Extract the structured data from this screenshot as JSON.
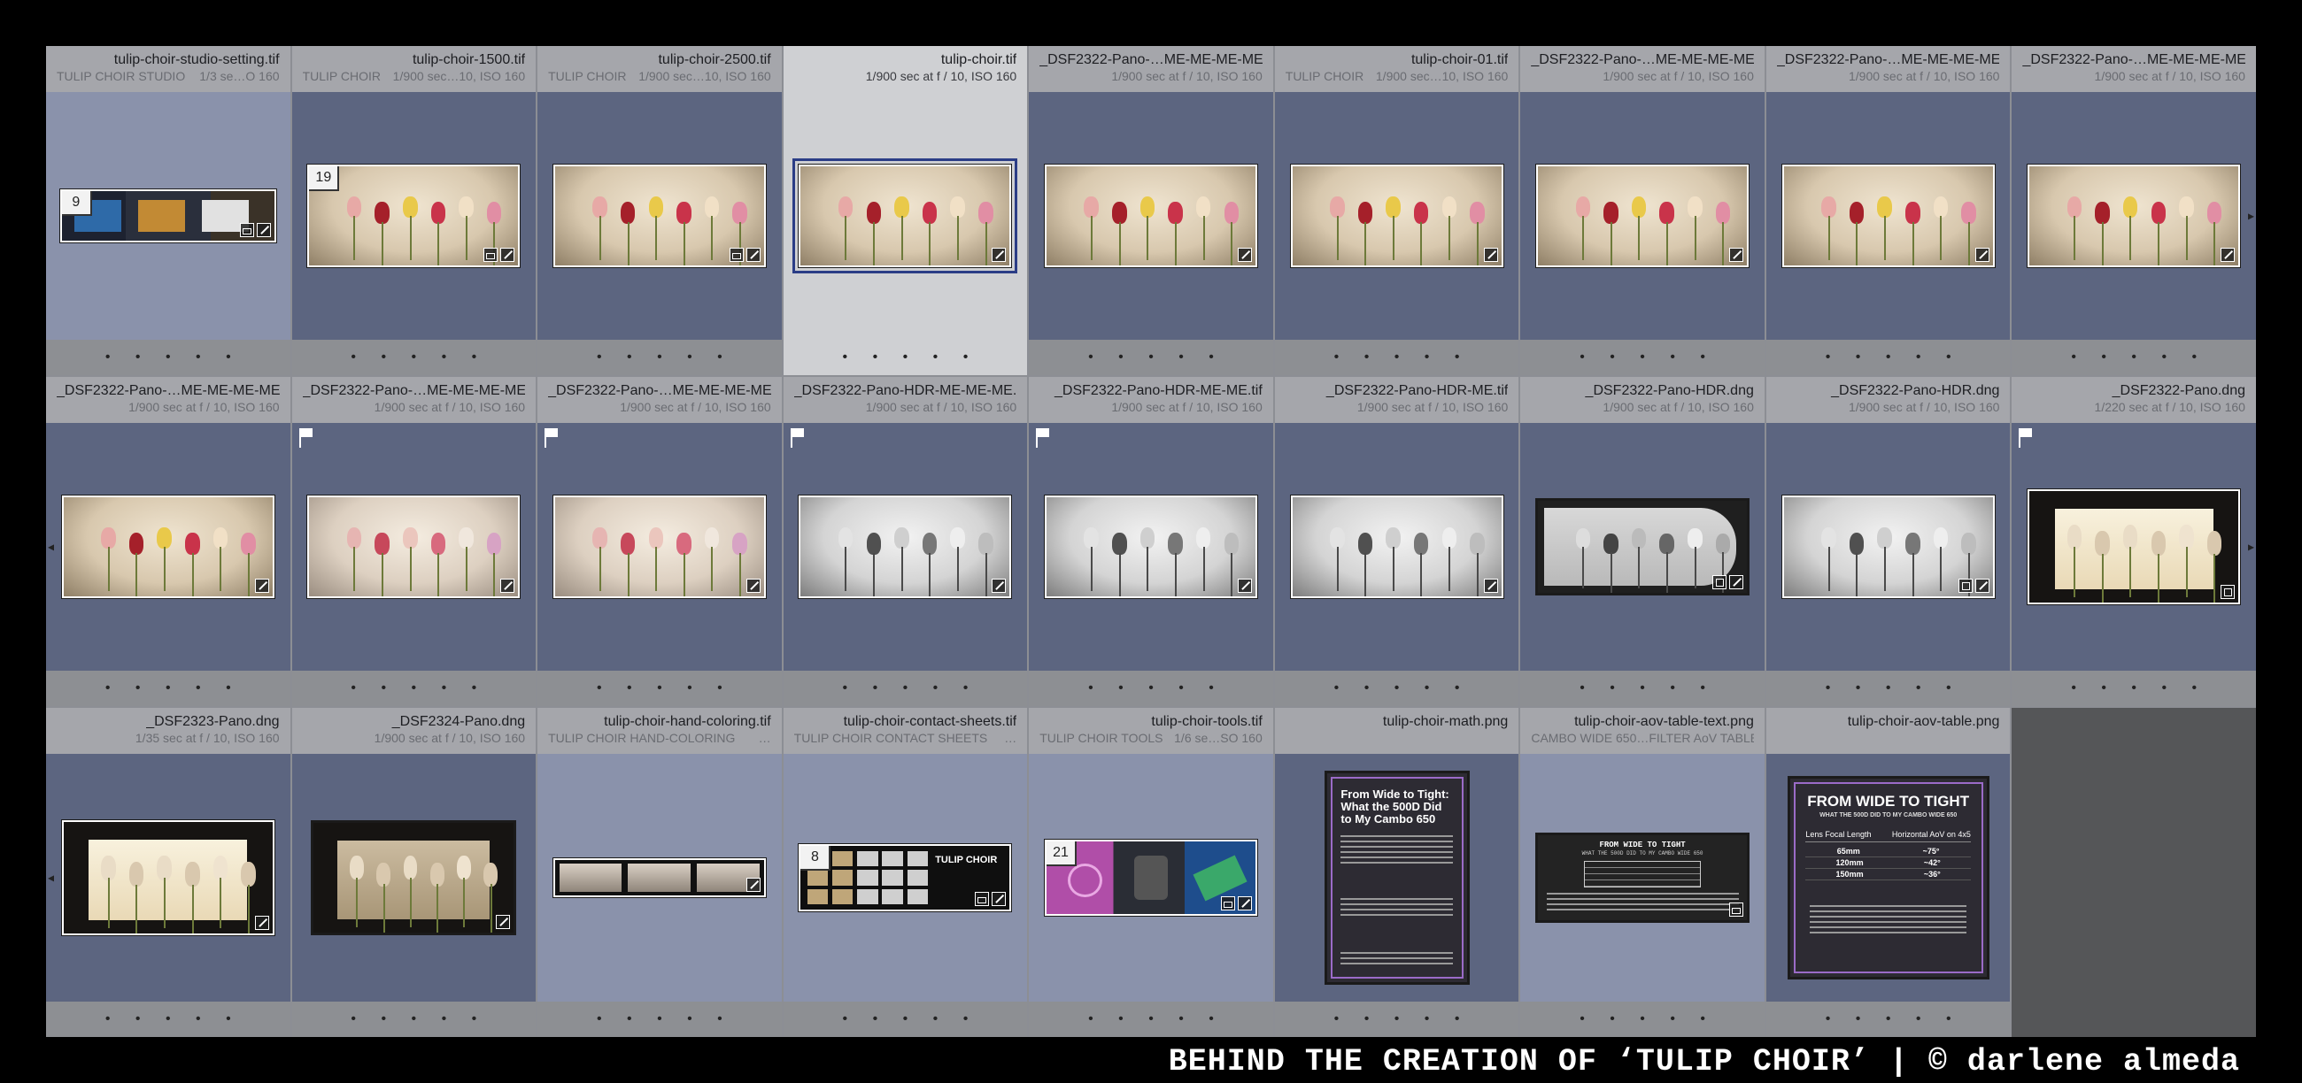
{
  "grid": {
    "cells": [
      {
        "filename": "tulip-choir-studio-setting.tif",
        "meta_left": "TULIP CHOIR STUDIO",
        "meta_right": "1/3 se…O 160",
        "badge": "9",
        "icons": [
          "stack",
          "edit"
        ],
        "flag": false
      },
      {
        "filename": "tulip-choir-1500.tif",
        "meta_left": "TULIP CHOIR",
        "meta_right": "1/900 sec…10, ISO 160",
        "badge": "19",
        "icons": [
          "stack",
          "edit"
        ],
        "flag": false
      },
      {
        "filename": "tulip-choir-2500.tif",
        "meta_left": "TULIP CHOIR",
        "meta_right": "1/900 sec…10, ISO 160",
        "badge": "",
        "icons": [
          "stack",
          "edit"
        ],
        "flag": false
      },
      {
        "filename": "tulip-choir.tif",
        "meta_left": "",
        "meta_right": "1/900 sec at f / 10, ISO 160",
        "badge": "",
        "icons": [
          "edit"
        ],
        "flag": false
      },
      {
        "filename": "_DSF2322-Pano-…ME-ME-ME-ME.tif",
        "meta_left": "",
        "meta_right": "1/900 sec at f / 10, ISO 160",
        "badge": "",
        "icons": [
          "edit"
        ],
        "flag": false
      },
      {
        "filename": "tulip-choir-01.tif",
        "meta_left": "TULIP CHOIR",
        "meta_right": "1/900 sec…10, ISO 160",
        "badge": "",
        "icons": [
          "edit"
        ],
        "flag": false
      },
      {
        "filename": "_DSF2322-Pano-…ME-ME-ME-ME.tif",
        "meta_left": "",
        "meta_right": "1/900 sec at f / 10, ISO 160",
        "badge": "",
        "icons": [
          "edit"
        ],
        "flag": false
      },
      {
        "filename": "_DSF2322-Pano-…ME-ME-ME-ME.tif",
        "meta_left": "",
        "meta_right": "1/900 sec at f / 10, ISO 160",
        "badge": "",
        "icons": [
          "edit"
        ],
        "flag": false
      },
      {
        "filename": "_DSF2322-Pano-…ME-ME-ME-ME.tif",
        "meta_left": "",
        "meta_right": "1/900 sec at f / 10, ISO 160",
        "badge": "",
        "icons": [
          "edit"
        ],
        "flag": false
      },
      {
        "filename": "_DSF2322-Pano-…ME-ME-ME-ME.tif",
        "meta_left": "",
        "meta_right": "1/900 sec at f / 10, ISO 160",
        "badge": "",
        "icons": [
          "edit"
        ],
        "flag": false
      },
      {
        "filename": "_DSF2322-Pano-…ME-ME-ME-ME.tif",
        "meta_left": "",
        "meta_right": "1/900 sec at f / 10, ISO 160",
        "badge": "",
        "icons": [
          "edit"
        ],
        "flag": true
      },
      {
        "filename": "_DSF2322-Pano-…ME-ME-ME-ME.tif",
        "meta_left": "",
        "meta_right": "1/900 sec at f / 10, ISO 160",
        "badge": "",
        "icons": [
          "edit"
        ],
        "flag": true
      },
      {
        "filename": "_DSF2322-Pano-HDR-ME-ME-ME.tif",
        "meta_left": "",
        "meta_right": "1/900 sec at f / 10, ISO 160",
        "badge": "",
        "icons": [
          "edit"
        ],
        "flag": true
      },
      {
        "filename": "_DSF2322-Pano-HDR-ME-ME.tif",
        "meta_left": "",
        "meta_right": "1/900 sec at f / 10, ISO 160",
        "badge": "",
        "icons": [
          "edit"
        ],
        "flag": true
      },
      {
        "filename": "_DSF2322-Pano-HDR-ME.tif",
        "meta_left": "",
        "meta_right": "1/900 sec at f / 10, ISO 160",
        "badge": "",
        "icons": [
          "edit"
        ],
        "flag": false
      },
      {
        "filename": "_DSF2322-Pano-HDR.dng",
        "meta_left": "",
        "meta_right": "1/900 sec at f / 10, ISO 160",
        "badge": "",
        "icons": [
          "crop",
          "edit"
        ],
        "flag": false
      },
      {
        "filename": "_DSF2322-Pano-HDR.dng",
        "meta_left": "",
        "meta_right": "1/900 sec at f / 10, ISO 160",
        "badge": "",
        "icons": [
          "crop",
          "edit"
        ],
        "flag": false
      },
      {
        "filename": "_DSF2322-Pano.dng",
        "meta_left": "",
        "meta_right": "1/220 sec at f / 10, ISO 160",
        "badge": "",
        "icons": [
          "crop"
        ],
        "flag": true
      },
      {
        "filename": "_DSF2323-Pano.dng",
        "meta_left": "",
        "meta_right": "1/35 sec at f / 10, ISO 160",
        "badge": "",
        "icons": [
          "edit"
        ],
        "flag": false
      },
      {
        "filename": "_DSF2324-Pano.dng",
        "meta_left": "",
        "meta_right": "1/900 sec at f / 10, ISO 160",
        "badge": "",
        "icons": [
          "edit"
        ],
        "flag": false
      },
      {
        "filename": "tulip-choir-hand-coloring.tif",
        "meta_left": "TULIP CHOIR HAND-COLORING",
        "meta_right": "…",
        "badge": "",
        "icons": [
          "edit"
        ],
        "flag": false
      },
      {
        "filename": "tulip-choir-contact-sheets.tif",
        "meta_left": "TULIP CHOIR CONTACT SHEETS",
        "meta_right": "…",
        "badge": "8",
        "icons": [
          "stack",
          "edit"
        ],
        "flag": false
      },
      {
        "filename": "tulip-choir-tools.tif",
        "meta_left": "TULIP CHOIR TOOLS",
        "meta_right": "1/6 se…SO 160",
        "badge": "21",
        "icons": [
          "stack",
          "edit"
        ],
        "flag": false
      },
      {
        "filename": "tulip-choir-math.png",
        "meta_left": "",
        "meta_right": "",
        "badge": "",
        "icons": [],
        "flag": false
      },
      {
        "filename": "tulip-choir-aov-table-text.png",
        "meta_left": "CAMBO WIDE 650…FILTER AoV TABLE",
        "meta_right": "",
        "badge": "",
        "icons": [
          "stack"
        ],
        "flag": false
      },
      {
        "filename": "tulip-choir-aov-table.png",
        "meta_left": "",
        "meta_right": "",
        "badge": "",
        "icons": [],
        "flag": false
      },
      {
        "filename": "",
        "meta_left": "",
        "meta_right": "",
        "badge": "",
        "icons": [],
        "flag": false
      }
    ]
  },
  "docs": {
    "math_title": "From Wide to Tight: What the 500D Did to My Cambo 650",
    "aov_text_title": "FROM WIDE TO TIGHT",
    "aov_text_subtitle": "WHAT THE 500D DID TO MY CAMBO WIDE 650",
    "aov_title": "FROM WIDE TO TIGHT",
    "aov_subtitle": "WHAT THE 500D DID TO MY CAMBO WIDE 650",
    "aov_col1": "Lens Focal Length",
    "aov_col2": "Horizontal AoV on 4x5",
    "aov_rows": [
      [
        "65mm",
        "~75°"
      ],
      [
        "120mm",
        "~42°"
      ],
      [
        "150mm",
        "~36°"
      ]
    ],
    "contact_sheet_label": "TULIP CHOIR"
  },
  "stars_label": "• • • • •",
  "footer_caption": "BEHIND THE CREATION OF ‘TULIP CHOIR’ | © darlene almeda",
  "colors": {
    "cell_dark": "#5c6580",
    "cell_light": "#8a92ab",
    "cell_selected": "#cfd0d3",
    "selection_outline": "#2b3d86"
  }
}
